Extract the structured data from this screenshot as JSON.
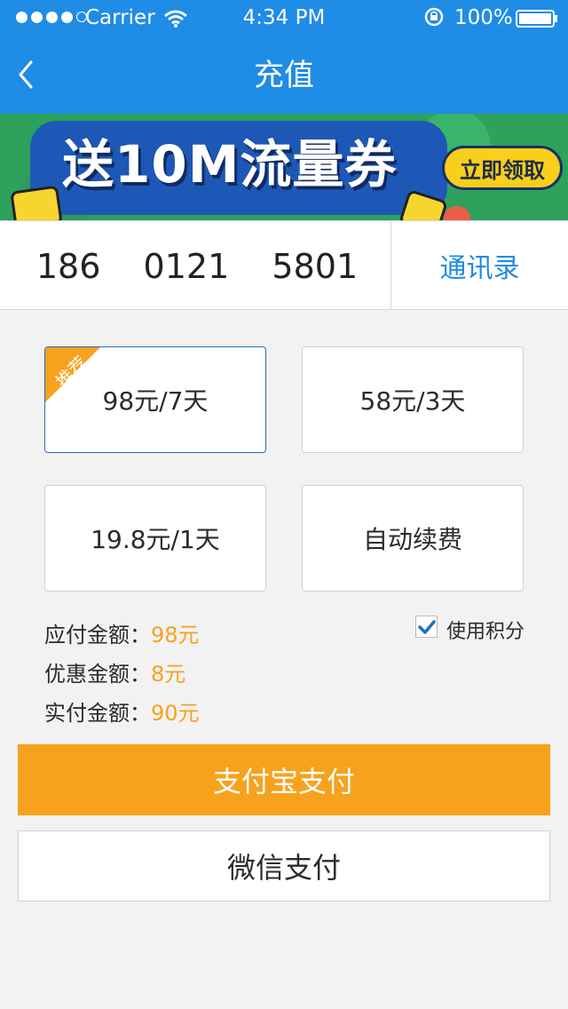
{
  "status_bar": {
    "carrier": "Carrier",
    "time": "4:34 PM",
    "battery": "100%"
  },
  "nav": {
    "title": "充值"
  },
  "banner": {
    "title": "送10M流量券",
    "claim_label": "立即领取"
  },
  "phone": {
    "number": "186  0121  5801",
    "contacts_label": "通讯录"
  },
  "plans": [
    {
      "label": "98元/7天",
      "badge": "推荐",
      "selected": true
    },
    {
      "label": "58元/3天",
      "selected": false
    },
    {
      "label": "19.8元/1天",
      "selected": false
    },
    {
      "label": "自动续费",
      "selected": false
    }
  ],
  "summary": {
    "payable_label": "应付金额：",
    "payable_value": "98元",
    "discount_label": "优惠金额：",
    "discount_value": "8元",
    "actual_label": "实付金额：",
    "actual_value": "90元"
  },
  "points": {
    "label": "使用积分",
    "checked": true
  },
  "payment": {
    "alipay_label": "支付宝支付",
    "wechat_label": "微信支付"
  },
  "colors": {
    "primary": "#1f8ce6",
    "accent": "#f7a21d",
    "background": "#f2f2f2"
  },
  "icons": {
    "back": "back-chevron-icon",
    "wifi": "wifi-icon",
    "battery": "battery-icon",
    "check": "check-icon"
  }
}
